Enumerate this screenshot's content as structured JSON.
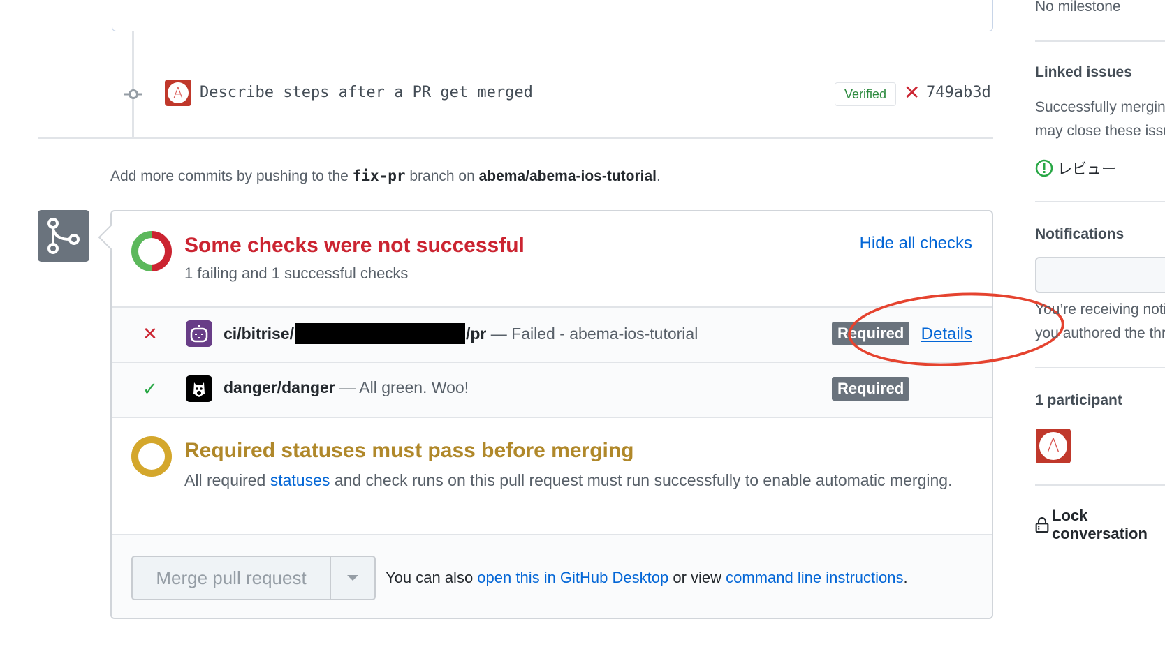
{
  "timeline": {
    "commit": {
      "avatar_letter": "A",
      "message": "Describe steps after a PR get merged",
      "verified_label": "Verified",
      "status": "failed",
      "sha": "749ab3d"
    },
    "push_note": {
      "prefix": "Add more commits by pushing to the ",
      "branch": "fix-pr",
      "middle": " branch on ",
      "repo": "abema/abema-ios-tutorial",
      "suffix": "."
    }
  },
  "merge_box": {
    "checks_summary": {
      "title": "Some checks were not successful",
      "subtitle": "1 failing and 1 successful checks",
      "toggle_label": "Hide all checks",
      "failing": 1,
      "successful": 1,
      "colors": {
        "fail": "#cb2431",
        "success": "#5cb85c"
      }
    },
    "checks": [
      {
        "status": "failed",
        "app": "bitrise",
        "name_prefix": "ci/bitrise/",
        "name_suffix": "/pr",
        "description": "— Failed - abema-ios-tutorial",
        "required_label": "Required",
        "details_label": "Details"
      },
      {
        "status": "success",
        "app": "danger",
        "name": "danger/danger",
        "description": "— All green. Woo!",
        "required_label": "Required"
      }
    ],
    "required_section": {
      "title": "Required statuses must pass before merging",
      "body_prefix": "All required ",
      "body_link": "statuses",
      "body_suffix": " and check runs on this pull request must run successfully to enable automatic merging.",
      "color": "#b0882a"
    },
    "footer": {
      "merge_button_label": "Merge pull request",
      "text_prefix": "You can also ",
      "desktop_link": "open this in GitHub Desktop",
      "text_middle": " or view ",
      "cli_link": "command line instructions",
      "text_suffix": "."
    }
  },
  "sidebar": {
    "milestone_text": "No milestone",
    "linked_issues_heading": "Linked issues",
    "linked_issues_desc_line1": "Successfully merging this pull request",
    "linked_issues_desc_line2": "may close these issues.",
    "linked_issue_title": "レビュー",
    "notifications_heading": "Notifications",
    "notifications_desc_line1": "You’re receiving notifications because",
    "notifications_desc_line2": "you authored the thread.",
    "participants_heading": "1 participant",
    "participant_avatar_letter": "A",
    "lock_label": "Lock conversation"
  }
}
